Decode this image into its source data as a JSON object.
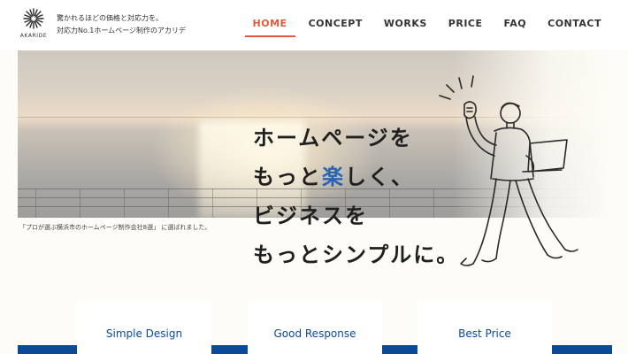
{
  "header": {
    "logo_text": "AKARIDE",
    "tagline_line1": "驚かれるほどの価格と対応力を。",
    "tagline_line2": "対応力No.1ホームページ制作のアカリデ"
  },
  "nav": [
    {
      "label": "HOME",
      "active": true
    },
    {
      "label": "CONCEPT",
      "active": false
    },
    {
      "label": "WORKS",
      "active": false
    },
    {
      "label": "PRICE",
      "active": false
    },
    {
      "label": "FAQ",
      "active": false
    },
    {
      "label": "CONTACT",
      "active": false
    }
  ],
  "hero": {
    "catch_line1": "ホームページを",
    "catch_line2_pre": "もっと",
    "catch_line2_highlight": "楽",
    "catch_line2_post": "しく、",
    "catch_line3": "ビジネスを",
    "catch_line4": "もっとシンプルに。",
    "caption": "「プロが選ぶ横浜市のホームページ制作会社8選」 に選ばれました。"
  },
  "features": [
    {
      "title": "Simple Design"
    },
    {
      "title": "Good Response"
    },
    {
      "title": "Best Price"
    }
  ],
  "colors": {
    "accent": "#e35a3a",
    "brand_blue": "#0b4a96",
    "highlight": "#2a63b5"
  }
}
